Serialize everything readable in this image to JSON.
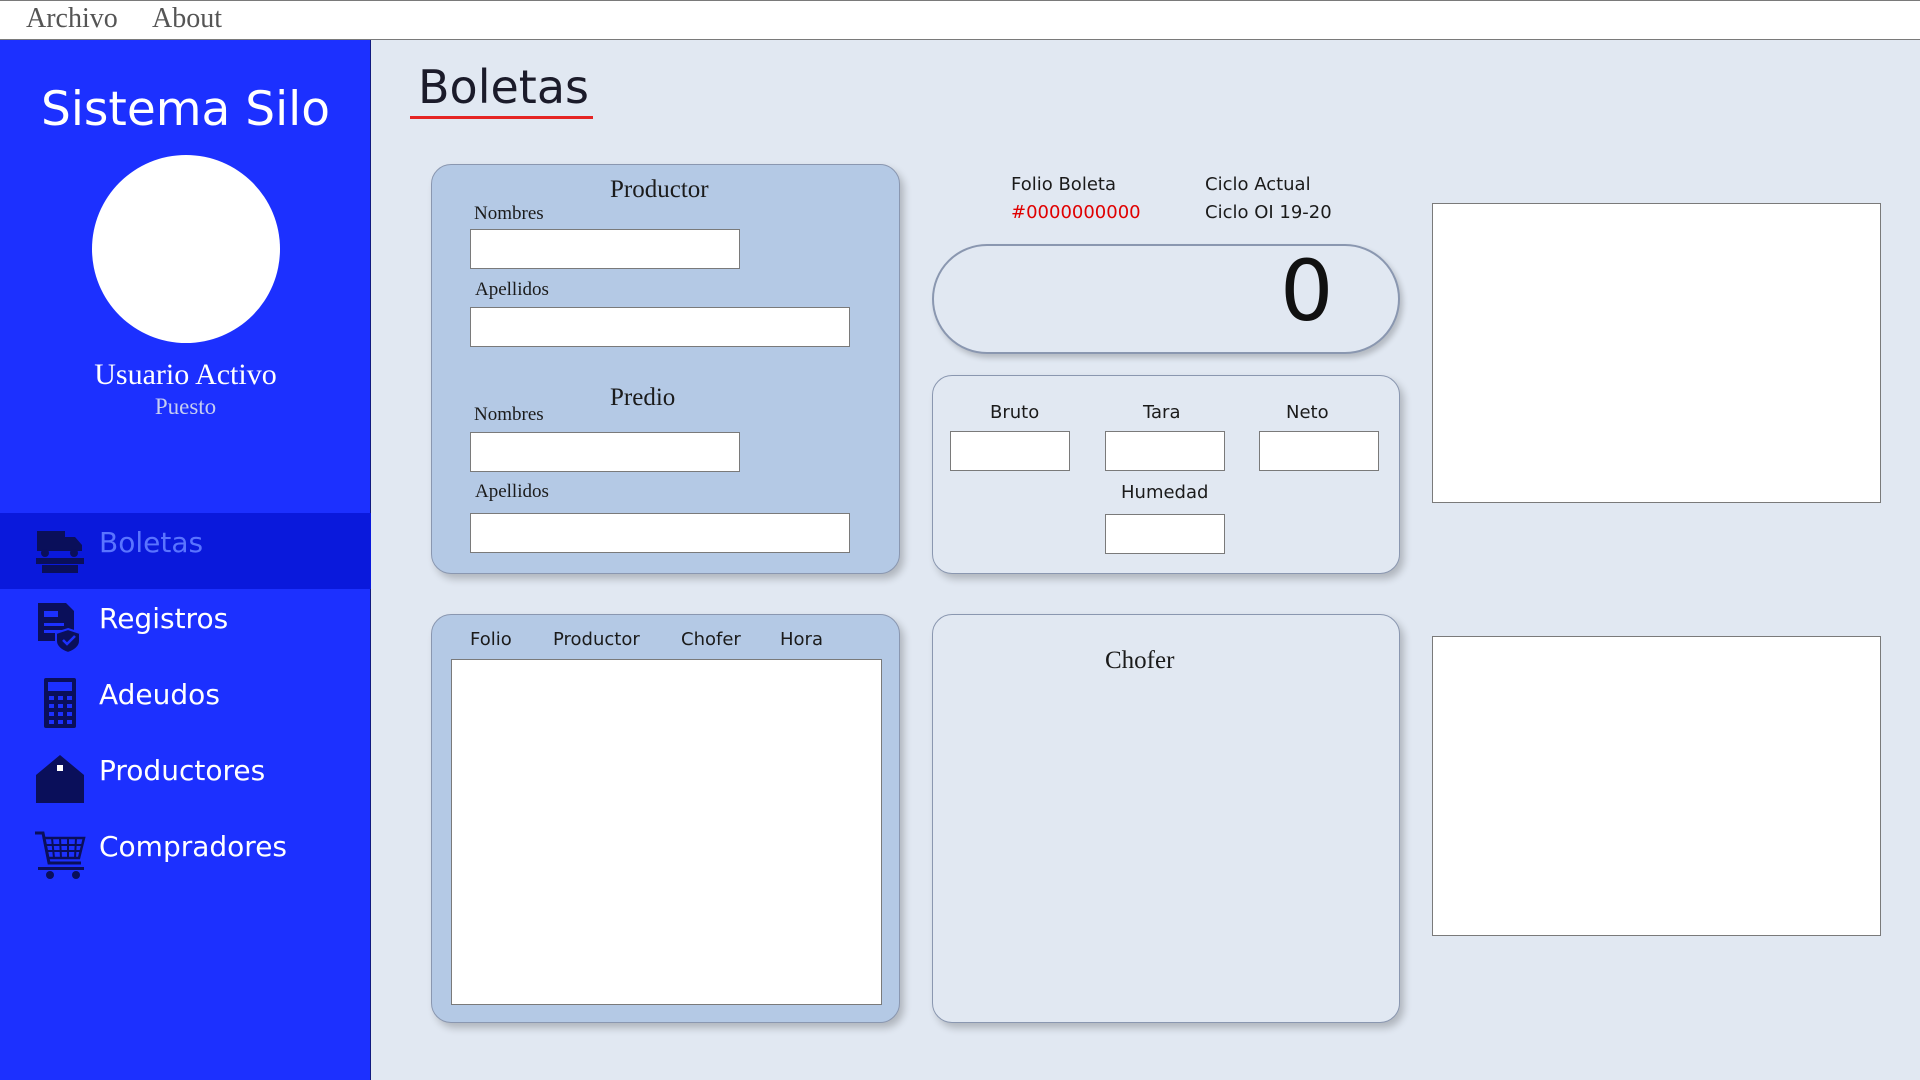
{
  "menubar": {
    "items": [
      "Archivo",
      "About"
    ]
  },
  "sidebar": {
    "app_title": "Sistema Silo",
    "user_name": "Usuario Activo",
    "user_role": "Puesto",
    "items": [
      {
        "label": "Boletas",
        "icon": "truck-scale-icon",
        "active": true
      },
      {
        "label": "Registros",
        "icon": "document-shield-icon",
        "active": false
      },
      {
        "label": "Adeudos",
        "icon": "calculator-icon",
        "active": false
      },
      {
        "label": "Productores",
        "icon": "house-icon",
        "active": false
      },
      {
        "label": "Compradores",
        "icon": "shopping-cart-icon",
        "active": false
      }
    ]
  },
  "main": {
    "page_title": "Boletas",
    "productor_panel": {
      "productor_heading": "Productor",
      "productor_nombres_label": "Nombres",
      "productor_apellidos_label": "Apellidos",
      "predio_heading": "Predio",
      "predio_nombres_label": "Nombres",
      "predio_apellidos_label": "Apellidos"
    },
    "folio": {
      "label": "Folio Boleta",
      "value": "#0000000000"
    },
    "ciclo": {
      "label": "Ciclo Actual",
      "value": "Ciclo OI 19-20"
    },
    "scale_reading": "0",
    "weights_panel": {
      "bruto_label": "Bruto",
      "tara_label": "Tara",
      "neto_label": "Neto",
      "humedad_label": "Humedad"
    },
    "list_panel": {
      "columns": [
        "Folio",
        "Productor",
        "Chofer",
        "Hora"
      ]
    },
    "chofer_panel": {
      "heading": "Chofer"
    }
  },
  "colors": {
    "sidebar": "#1c30ff",
    "sidebar_active": "#0a19dc",
    "panel_blue": "#b4c9e5",
    "background": "#e1e8f2",
    "accent_red": "#e52424"
  }
}
